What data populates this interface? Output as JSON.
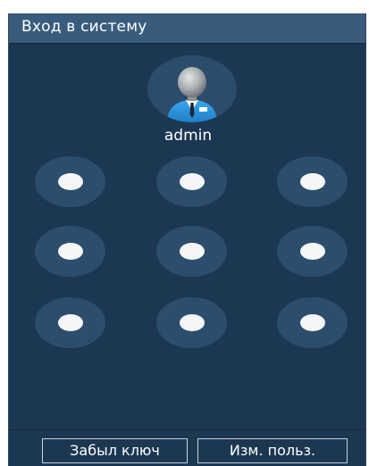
{
  "window": {
    "title": "Вход в систему"
  },
  "user": {
    "name": "admin",
    "avatar_icon": "user-avatar-icon"
  },
  "pattern": {
    "rows": 3,
    "cols": 3,
    "nodes": [
      "node-1",
      "node-2",
      "node-3",
      "node-4",
      "node-5",
      "node-6",
      "node-7",
      "node-8",
      "node-9"
    ]
  },
  "buttons": {
    "forgot_label": "Забыл ключ",
    "switch_user_label": "Изм. польз."
  },
  "colors": {
    "window_bg": "#1c3752",
    "titlebar_bg": "#3a5c7c",
    "node_bg": "#2d4d6d",
    "dot": "#f4f6f8",
    "accent_blue": "#2b8fd6"
  }
}
